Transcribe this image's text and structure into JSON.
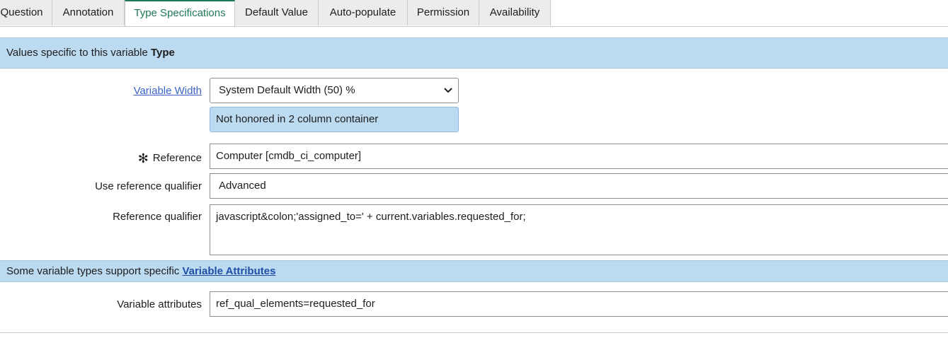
{
  "tabs": [
    {
      "label": "Question",
      "active": false
    },
    {
      "label": "Annotation",
      "active": false
    },
    {
      "label": "Type Specifications",
      "active": true
    },
    {
      "label": "Default Value",
      "active": false
    },
    {
      "label": "Auto-populate",
      "active": false
    },
    {
      "label": "Permission",
      "active": false
    },
    {
      "label": "Availability",
      "active": false
    }
  ],
  "type_section": {
    "header_text": "Values specific to this variable ",
    "header_bold": "Type"
  },
  "variable_width": {
    "label": "Variable Width",
    "value": "System Default Width (50) %",
    "info": "Not honored in 2 column container"
  },
  "reference": {
    "required_mark": "✻",
    "label": "Reference",
    "value": "Computer [cmdb_ci_computer]"
  },
  "use_reference_qualifier": {
    "label": "Use reference qualifier",
    "value": "Advanced"
  },
  "reference_qualifier": {
    "label": "Reference qualifier",
    "value": "javascript&colon;'assigned_to=' + current.variables.requested_for;"
  },
  "attributes_section": {
    "header_text": "Some variable types support specific ",
    "header_link": "Variable Attributes"
  },
  "variable_attributes": {
    "label": "Variable attributes",
    "value": "ref_qual_elements=requested_for"
  },
  "colors": {
    "active_tab": "#1e7a55",
    "section_bg": "#bcdaf0",
    "link": "#3a63c9"
  }
}
